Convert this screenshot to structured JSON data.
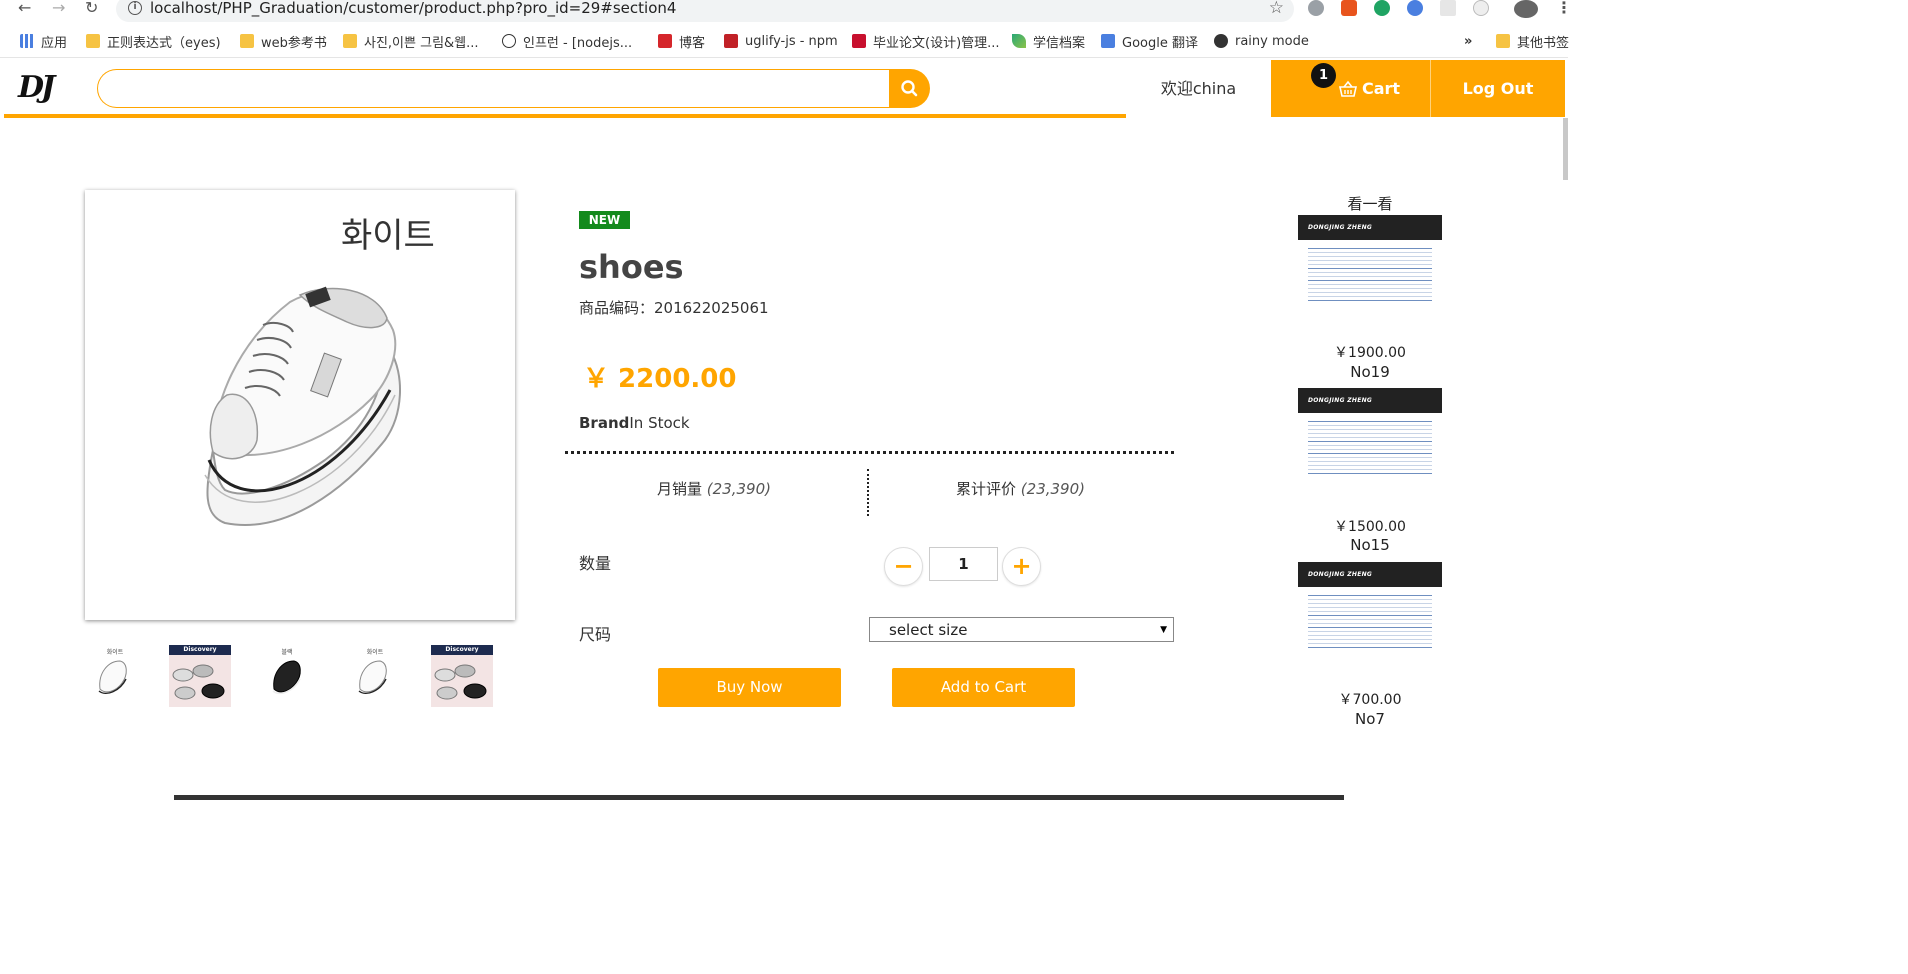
{
  "browser": {
    "url": "localhost/PHP_Graduation/customer/product.php?pro_id=29#section4",
    "bookmarks": [
      "应用",
      "正则表达式（eyes)",
      "web参考书",
      "사진,이쁜 그림&웹...",
      "인프런 - [nodejs...",
      "博客",
      "uglify-js - npm",
      "毕业论文(设计)管理...",
      "学信档案",
      "Google 翻译",
      "rainy mode"
    ],
    "more_bookmarks": "»",
    "other_bookmarks": "其他书签"
  },
  "header": {
    "logo": "DJ",
    "search_placeholder": "",
    "welcome": "欢迎china",
    "cart_count": "1",
    "cart_label": "Cart",
    "logout_label": "Log Out"
  },
  "product": {
    "image_caption": "화이트",
    "thumbnails": [
      {
        "label": "화이트",
        "color": "white"
      },
      {
        "label": "Discovery",
        "color": "multi"
      },
      {
        "label": "블랙",
        "color": "black"
      },
      {
        "label": "화이트",
        "color": "white"
      },
      {
        "label": "Discovery",
        "color": "multi"
      }
    ],
    "badge": "NEW",
    "name": "shoes",
    "code_label": "商品编码：",
    "code": "201622025061",
    "price": "￥ 2200.00",
    "brand_label": "Brand",
    "stock_status": "In Stock",
    "monthly_sales_label": "月销量",
    "monthly_sales": "(23,390)",
    "reviews_label": "累计评价",
    "reviews": "(23,390)",
    "quantity_label": "数量",
    "quantity": "1",
    "size_label": "尺码",
    "size_selected": "select size",
    "buy_now": "Buy Now",
    "add_to_cart": "Add to Cart"
  },
  "recommendations": {
    "title": "看一看",
    "items": [
      {
        "header": "DONGJING ZHENG",
        "price": "￥1900.00",
        "no": "No19"
      },
      {
        "header": "DONGJING ZHENG",
        "price": "￥1500.00",
        "no": "No15"
      },
      {
        "header": "DONGJING ZHENG",
        "price": "￥700.00",
        "no": "No7"
      }
    ]
  },
  "colors": {
    "accent": "#ffa500",
    "new_badge": "#138a1c",
    "dark": "#222222"
  }
}
